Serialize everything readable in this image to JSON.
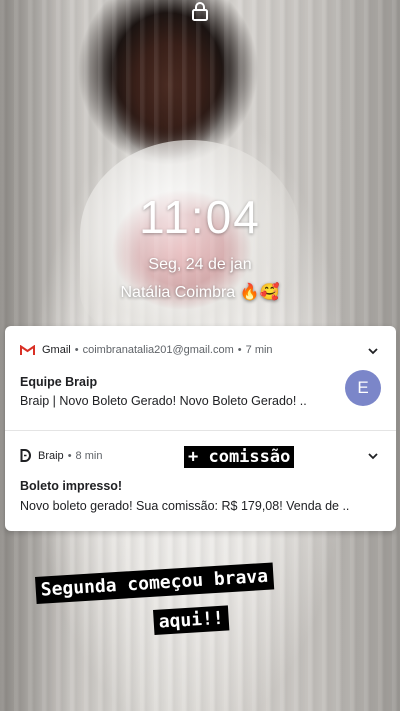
{
  "lockscreen": {
    "time": "11:04",
    "date": "Seg, 24 de jan",
    "owner_name": "Natália Coimbra"
  },
  "notifications": [
    {
      "app": "Gmail",
      "account": "coimbranatalia201@gmail.com",
      "time": "7 min",
      "title": "Equipe Braip",
      "text": "Braip | Novo Boleto Gerado! Novo Boleto Gerado! ..",
      "avatar_letter": "E",
      "icon": "gmail-icon"
    },
    {
      "app": "Braip",
      "time": "8 min",
      "title": "Boleto impresso!",
      "text": "Novo boleto gerado! Sua comissão: R$ 179,08! Venda de ..",
      "icon": "braip-icon"
    }
  ],
  "stickers": {
    "commission": "+ comissão",
    "caption_line1": "Segunda começou brava",
    "caption_line2": "aqui!!"
  },
  "colors": {
    "avatar": "#7b86c9",
    "gmail_red": "#d93025",
    "text_primary": "#202124",
    "text_secondary": "#5f6368"
  }
}
